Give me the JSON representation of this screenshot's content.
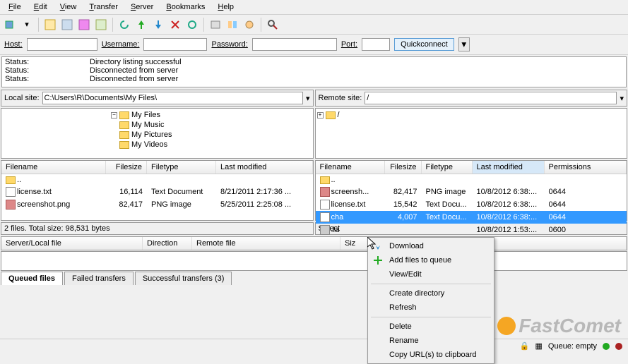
{
  "menu": [
    "File",
    "Edit",
    "View",
    "Transfer",
    "Server",
    "Bookmarks",
    "Help"
  ],
  "quickconnect": {
    "host_label": "Host:",
    "username_label": "Username:",
    "password_label": "Password:",
    "port_label": "Port:",
    "button": "Quickconnect"
  },
  "status_log": [
    {
      "label": "Status:",
      "msg": "Directory listing successful"
    },
    {
      "label": "Status:",
      "msg": "Disconnected from server"
    },
    {
      "label": "Status:",
      "msg": "Disconnected from server"
    }
  ],
  "local": {
    "site_label": "Local site:",
    "path": "C:\\Users\\R\\Documents\\My Files\\",
    "tree": [
      "My Files",
      "My Music",
      "My Pictures",
      "My Videos"
    ],
    "columns": [
      "Filename",
      "Filesize",
      "Filetype",
      "Last modified"
    ],
    "rows": [
      {
        "icon": "folder",
        "name": "..",
        "size": "",
        "type": "",
        "mod": ""
      },
      {
        "icon": "txt",
        "name": "license.txt",
        "size": "16,114",
        "type": "Text Document",
        "mod": "8/21/2011 2:17:36 ..."
      },
      {
        "icon": "png",
        "name": "screenshot.png",
        "size": "82,417",
        "type": "PNG image",
        "mod": "5/25/2011 2:25:08 ..."
      }
    ],
    "summary": "2 files. Total size: 98,531 bytes"
  },
  "remote": {
    "site_label": "Remote site:",
    "path": "/",
    "tree_root": "/",
    "columns": [
      "Filename",
      "Filesize",
      "Filetype",
      "Last modified",
      "Permissions"
    ],
    "rows": [
      {
        "icon": "folder",
        "name": "..",
        "size": "",
        "type": "",
        "mod": "",
        "perm": ""
      },
      {
        "icon": "png",
        "name": "screensh...",
        "size": "82,417",
        "type": "PNG image",
        "mod": "10/8/2012 6:38:...",
        "perm": "0644"
      },
      {
        "icon": "txt",
        "name": "license.txt",
        "size": "15,542",
        "type": "Text Docu...",
        "mod": "10/8/2012 6:38:...",
        "perm": "0644"
      },
      {
        "icon": "txt",
        "name": "cha",
        "size": "4,007",
        "type": "Text Docu...",
        "mod": "10/8/2012 6:38:...",
        "perm": "0644",
        "selected": true
      },
      {
        "icon": "la",
        "name": ".la",
        "size": "",
        "type": "",
        "mod": "10/8/2012 1:53:...",
        "perm": "0600"
      }
    ],
    "summary": "Select"
  },
  "queue": {
    "columns": [
      "Server/Local file",
      "Direction",
      "Remote file",
      "Siz"
    ],
    "tabs": [
      {
        "label": "Queued files",
        "active": true
      },
      {
        "label": "Failed transfers",
        "active": false
      },
      {
        "label": "Successful transfers (3)",
        "active": false
      }
    ]
  },
  "context_menu": [
    {
      "label": "Download",
      "icon": "download"
    },
    {
      "label": "Add files to queue",
      "icon": "add"
    },
    {
      "label": "View/Edit"
    },
    {
      "sep": true
    },
    {
      "label": "Create directory"
    },
    {
      "label": "Refresh"
    },
    {
      "sep": true
    },
    {
      "label": "Delete"
    },
    {
      "label": "Rename"
    },
    {
      "label": "Copy URL(s) to clipboard"
    }
  ],
  "statusbar": {
    "queue": "Queue: empty"
  },
  "watermark": "FastComet"
}
